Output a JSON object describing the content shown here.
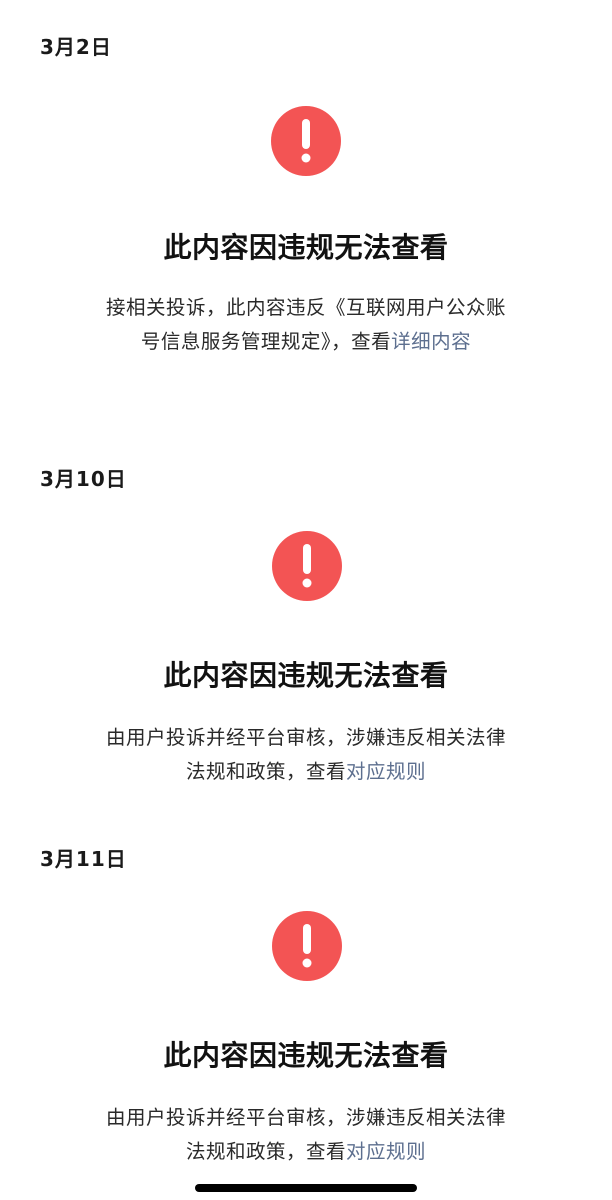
{
  "notices": [
    {
      "date": "3月2日",
      "title": "此内容因违规无法查看",
      "line1": "接相关投诉，此内容违反《互联网用户公众账",
      "line2_text": "号信息服务管理规定》，查看",
      "link": "详细内容"
    },
    {
      "date": "3月10日",
      "title": "此内容因违规无法查看",
      "line1": "由用户投诉并经平台审核，涉嫌违反相关法律",
      "line2_text": "法规和政策，查看",
      "link": "对应规则"
    },
    {
      "date": "3月11日",
      "title": "此内容因违规无法查看",
      "line1": "由用户投诉并经平台审核，涉嫌违反相关法律",
      "line2_text": "法规和政策，查看",
      "link": "对应规则"
    }
  ],
  "colors": {
    "alert": "#f35454",
    "link": "#5d6f8f",
    "background": "#ffffff"
  },
  "icons": {
    "alert": "exclamation-circle-icon"
  }
}
